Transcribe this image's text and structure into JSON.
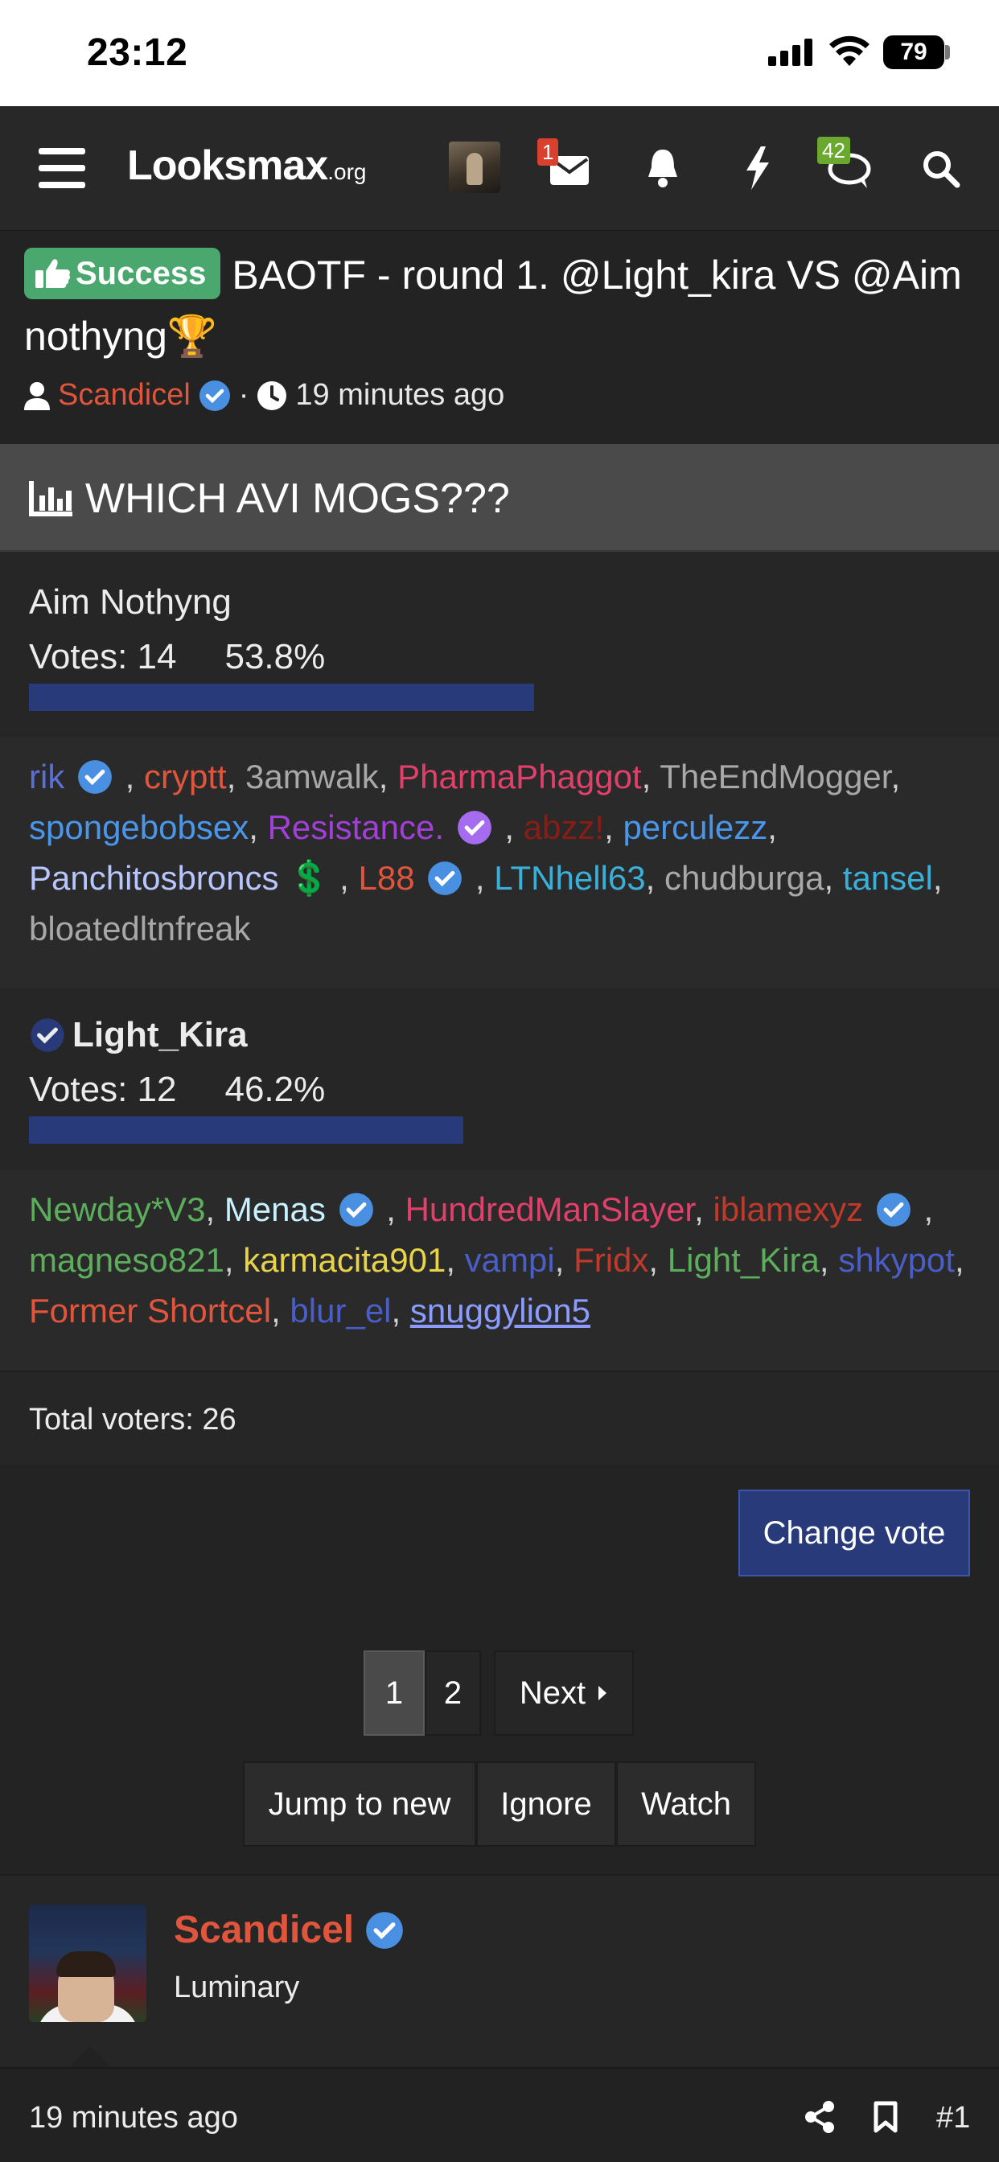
{
  "status_bar": {
    "time": "23:12",
    "battery": "79"
  },
  "nav": {
    "logo_main": "Looksmax",
    "logo_suffix": ".org",
    "inbox_badge": "1",
    "chat_badge": "42"
  },
  "thread": {
    "prefix_label": "Success",
    "title": "BAOTF - round 1. @Light_kira VS @Aim nothyng🏆",
    "author": "Scandicel",
    "separator": "·",
    "time": "19 minutes ago"
  },
  "poll": {
    "question": "WHICH AVI MOGS???",
    "responses": [
      {
        "label": "Aim Nothyng",
        "votes_text": "Votes: 14",
        "percent_text": "53.8%",
        "percent": 53.8,
        "voters": [
          {
            "name": "rik",
            "color": "#5a6fd6",
            "verified": true
          },
          {
            "name": "cryptt",
            "color": "#e0553c"
          },
          {
            "name": "3amwalk",
            "color": "#a8a8a8"
          },
          {
            "name": "PharmaPhaggot",
            "color": "#e0406a"
          },
          {
            "name": "TheEndMogger",
            "color": "#a8a8a8"
          },
          {
            "name": "spongebobsex",
            "color": "#4a96ea"
          },
          {
            "name": "Resistance.",
            "color": "#a23fd6",
            "verified": true
          },
          {
            "name": "abzz!",
            "color": "#8a1c14"
          },
          {
            "name": "perculezz",
            "color": "#4a96ea"
          },
          {
            "name": "Panchitosbroncs",
            "color": "#b8c6ff",
            "suffix": "💲"
          },
          {
            "name": "L88",
            "color": "#e0553c",
            "verified": true
          },
          {
            "name": "LTNhell63",
            "color": "#3ab0d8"
          },
          {
            "name": "chudburga",
            "color": "#a8a8a8"
          },
          {
            "name": "tansel",
            "color": "#3ab0d8"
          },
          {
            "name": "bloatedltnfreak",
            "color": "#a8a8a8"
          }
        ]
      },
      {
        "label": "Light_Kira",
        "votes_text": "Votes: 12",
        "percent_text": "46.2%",
        "percent": 46.2,
        "voters": [
          {
            "name": "Newday*V3",
            "color": "#5cae5c"
          },
          {
            "name": "Menas",
            "color": "#c8f2ff",
            "verified": true
          },
          {
            "name": "HundredManSlayer",
            "color": "#e0406a"
          },
          {
            "name": "iblamexyz",
            "color": "#c0392b",
            "verified": true
          },
          {
            "name": "magneso821",
            "color": "#5cae5c"
          },
          {
            "name": "karmacita901",
            "color": "#e8d44a"
          },
          {
            "name": "vampi",
            "color": "#4a5ec8"
          },
          {
            "name": "Fridx",
            "color": "#c0392b"
          },
          {
            "name": "Light_Kira",
            "color": "#5cae5c"
          },
          {
            "name": "shkypot",
            "color": "#4a5ec8"
          },
          {
            "name": "Former Shortcel",
            "color": "#e0553c"
          },
          {
            "name": "blur_el",
            "color": "#4a5ec8"
          },
          {
            "name": "snuggylion5",
            "color": "#8a9cff"
          }
        ]
      }
    ],
    "total": "Total voters: 26",
    "change_vote": "Change vote"
  },
  "pagination": {
    "page1": "1",
    "page2": "2",
    "next": "Next"
  },
  "thread_actions": {
    "jump": "Jump to new",
    "ignore": "Ignore",
    "watch": "Watch"
  },
  "post": {
    "author": "Scandicel",
    "role": "Luminary",
    "time": "19 minutes ago",
    "number": "#1"
  },
  "colors": {
    "accent": "#283a7a",
    "success": "#4aa86e",
    "verified": "#4a90e2",
    "author": "#e0553c"
  }
}
